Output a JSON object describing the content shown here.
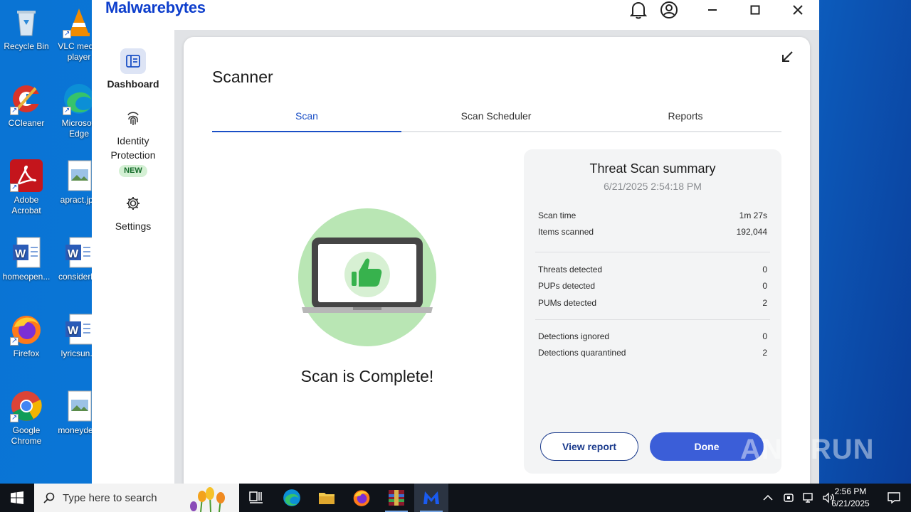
{
  "desktop": {
    "icons": [
      {
        "label": "Recycle Bin"
      },
      {
        "label": "VLC media player"
      },
      {
        "label": "CCleaner"
      },
      {
        "label": "Microsoft Edge"
      },
      {
        "label": "Adobe Acrobat"
      },
      {
        "label": "apract.jpg"
      },
      {
        "label": "homeopen..."
      },
      {
        "label": "considerl..."
      },
      {
        "label": "Firefox"
      },
      {
        "label": "lyricsun..."
      },
      {
        "label": "Google Chrome"
      },
      {
        "label": "moneyde..."
      }
    ]
  },
  "app": {
    "brand": "Malwarebytes",
    "sidebar": {
      "items": [
        {
          "label": "Dashboard",
          "icon": "dashboard-icon"
        },
        {
          "label": "Identity Protection",
          "badge": "NEW",
          "icon": "fingerprint-icon"
        },
        {
          "label": "Settings",
          "icon": "gear-icon"
        }
      ]
    },
    "scanner": {
      "title": "Scanner",
      "tabs": [
        {
          "label": "Scan",
          "active": true
        },
        {
          "label": "Scan Scheduler",
          "active": false
        },
        {
          "label": "Reports",
          "active": false
        }
      ],
      "status_text": "Scan is Complete!",
      "summary": {
        "title": "Threat Scan summary",
        "date": "6/21/2025 2:54:18 PM",
        "rows": [
          {
            "label": "Scan time",
            "value": "1m 27s"
          },
          {
            "label": "Items scanned",
            "value": "192,044"
          },
          {
            "label": "Threats detected",
            "value": "0"
          },
          {
            "label": "PUPs detected",
            "value": "0"
          },
          {
            "label": "PUMs detected",
            "value": "2"
          },
          {
            "label": "Detections ignored",
            "value": "0"
          },
          {
            "label": "Detections quarantined",
            "value": "2"
          }
        ],
        "view_report_label": "View report",
        "done_label": "Done"
      }
    },
    "colors": {
      "accent": "#1a4fc6",
      "done": "#3b5ed8",
      "success": "#b9e6b4",
      "thumb": "#37b24d"
    }
  },
  "watermark": "ANY RUN",
  "taskbar": {
    "search_placeholder": "Type here to search",
    "time": "2:56 PM",
    "date": "6/21/2025"
  }
}
